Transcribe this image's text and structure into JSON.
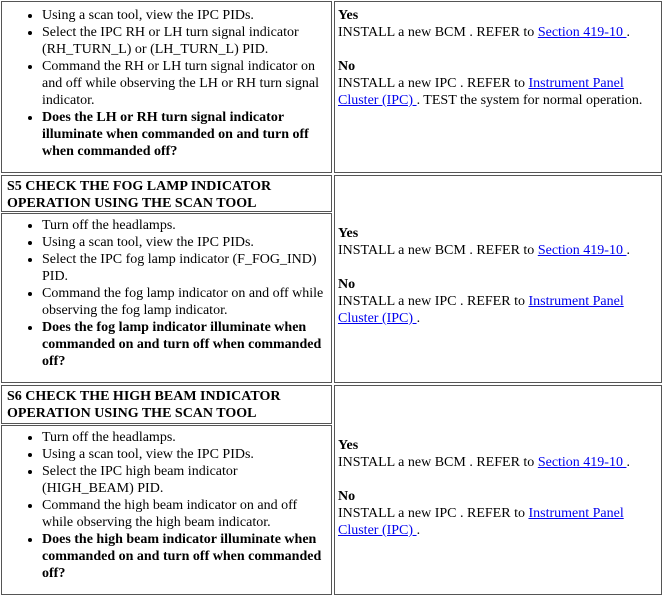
{
  "rows": [
    {
      "steps": [
        "Using a scan tool, view the IPC PIDs.",
        "Select the IPC RH or LH turn signal indicator (RH_TURN_L) or (LH_TURN_L) PID.",
        "Command the RH or LH turn signal indicator on and off while observing the LH or RH turn signal indicator."
      ],
      "question": "Does the LH or RH turn signal indicator illuminate when commanded on and turn off when commanded off?",
      "yes_label": "Yes",
      "yes_text": "INSTALL a new BCM . REFER to ",
      "yes_link": "Section 419-10 ",
      "yes_after": ".",
      "no_label": "No",
      "no_text": "INSTALL a new IPC . REFER to ",
      "no_link": "Instrument Panel Cluster (IPC) ",
      "no_after": ". TEST the system for normal operation."
    },
    {
      "header": "S5 CHECK THE FOG LAMP INDICATOR OPERATION USING THE SCAN TOOL",
      "steps": [
        "Turn off the headlamps.",
        "Using a scan tool, view the IPC PIDs.",
        "Select the IPC fog lamp indicator (F_FOG_IND) PID.",
        "Command the fog lamp indicator on and off while observing the fog lamp indicator."
      ],
      "question": "Does the fog lamp indicator illuminate when commanded on and turn off when commanded off?",
      "yes_label": "Yes",
      "yes_text": "INSTALL a new BCM . REFER to ",
      "yes_link": "Section 419-10 ",
      "yes_after": ".",
      "no_label": "No",
      "no_text": "INSTALL a new IPC . REFER to ",
      "no_link": "Instrument Panel Cluster (IPC) ",
      "no_after": "."
    },
    {
      "header": "S6 CHECK THE HIGH BEAM INDICATOR OPERATION USING THE SCAN TOOL",
      "steps": [
        "Turn off the headlamps.",
        "Using a scan tool, view the IPC PIDs.",
        "Select the IPC high beam indicator (HIGH_BEAM) PID.",
        "Command the high beam indicator on and off while observing the high beam indicator."
      ],
      "question": "Does the high beam indicator illuminate when commanded on and turn off when commanded off?",
      "yes_label": "Yes",
      "yes_text": "INSTALL a new BCM . REFER to ",
      "yes_link": "Section 419-10 ",
      "yes_after": ".",
      "no_label": "No",
      "no_text": "INSTALL a new IPC . REFER to ",
      "no_link": "Instrument Panel Cluster (IPC) ",
      "no_after": "."
    }
  ]
}
